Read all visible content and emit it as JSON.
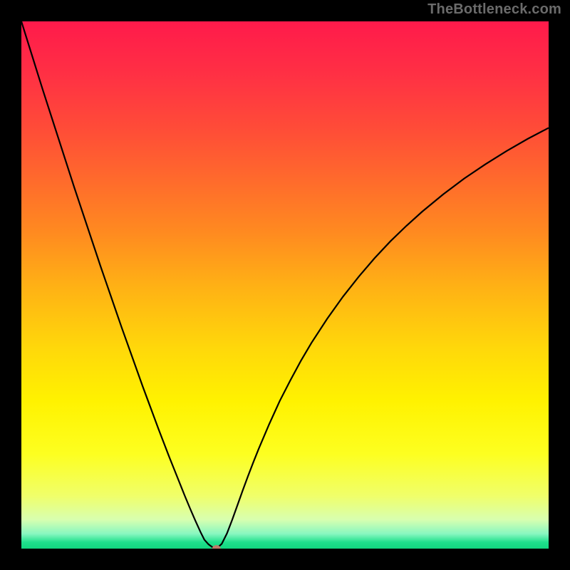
{
  "watermark": "TheBottleneck.com",
  "colors": {
    "page_bg": "#000000",
    "curve": "#000000",
    "marker": "#bd7b69"
  },
  "gradient_stops": [
    {
      "offset": 0.0,
      "color": "#ff1a4b"
    },
    {
      "offset": 0.1,
      "color": "#ff3044"
    },
    {
      "offset": 0.2,
      "color": "#ff4b38"
    },
    {
      "offset": 0.3,
      "color": "#ff6a2c"
    },
    {
      "offset": 0.4,
      "color": "#ff8a20"
    },
    {
      "offset": 0.5,
      "color": "#ffb015"
    },
    {
      "offset": 0.62,
      "color": "#ffd80a"
    },
    {
      "offset": 0.72,
      "color": "#fff200"
    },
    {
      "offset": 0.82,
      "color": "#fdff20"
    },
    {
      "offset": 0.9,
      "color": "#f0ff6a"
    },
    {
      "offset": 0.945,
      "color": "#d8ffb0"
    },
    {
      "offset": 0.972,
      "color": "#88f7c0"
    },
    {
      "offset": 0.988,
      "color": "#1fe08c"
    },
    {
      "offset": 1.0,
      "color": "#12d67f"
    }
  ],
  "chart_data": {
    "type": "line",
    "title": "",
    "xlabel": "",
    "ylabel": "",
    "xlim": [
      0,
      100
    ],
    "ylim": [
      0,
      100
    ],
    "minimum": {
      "x": 37,
      "y": 0
    },
    "series": [
      {
        "name": "curve",
        "x": [
          0,
          1,
          2,
          3,
          4,
          5,
          6,
          7,
          8,
          9,
          10,
          11,
          12,
          13,
          14,
          15,
          16,
          17,
          18,
          19,
          20,
          21,
          22,
          23,
          24,
          25,
          26,
          27,
          28,
          29,
          30,
          31,
          32,
          33,
          34,
          34.7,
          35.5,
          36.2,
          37,
          38,
          39,
          40,
          41,
          42,
          43,
          44,
          45,
          47,
          49,
          51,
          53,
          55,
          58,
          61,
          64,
          67,
          70,
          73,
          76,
          80,
          84,
          88,
          92,
          96,
          100
        ],
        "y": [
          100,
          96.8,
          93.6,
          90.4,
          87.2,
          84.1,
          81.0,
          77.9,
          74.8,
          71.7,
          68.6,
          65.6,
          62.6,
          59.6,
          56.6,
          53.6,
          50.7,
          47.8,
          44.9,
          42.0,
          39.2,
          36.4,
          33.6,
          30.8,
          28.1,
          25.4,
          22.7,
          20.1,
          17.5,
          15.0,
          12.5,
          10.0,
          7.6,
          5.3,
          3.1,
          1.7,
          0.8,
          0.3,
          0.0,
          0.9,
          2.9,
          5.5,
          8.3,
          11.1,
          13.8,
          16.4,
          18.9,
          23.6,
          28.0,
          31.9,
          35.6,
          39.0,
          43.6,
          47.8,
          51.6,
          55.1,
          58.3,
          61.2,
          63.9,
          67.2,
          70.2,
          72.9,
          75.4,
          77.7,
          79.8
        ]
      }
    ]
  }
}
